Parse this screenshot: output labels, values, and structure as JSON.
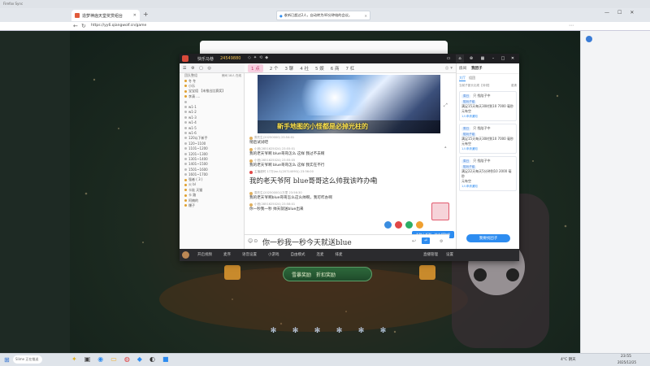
{
  "window_top": {
    "left_text": "Firefox Sync"
  },
  "tabs": [
    {
      "label": "造梦神庙天堂奖赏组台",
      "active": true
    },
    {
      "label": "",
      "active": false
    }
  ],
  "notification": {
    "text": "收听已超过2人，自动转为40分钟结的会议。"
  },
  "address": {
    "url": "https://yy6.qiangwolf.cn/game"
  },
  "app": {
    "title": {
      "brand": "快乐马巷",
      "id": "24549880"
    },
    "toolbar": {
      "label": "团队整组",
      "right_text": "房间 18人 在线"
    },
    "page_tabs": [
      "1 点",
      "2 个",
      "3 聊",
      "4 社",
      "5 娱",
      "6 商",
      "7 杠"
    ],
    "users": [
      "冬 冬",
      "小乐",
      "宝宝组 【未推出比赛奖】",
      "李清 ....",
      "",
      "w1-1",
      "w1-2",
      "w1-3",
      "w1-4",
      "w1-5",
      "w1-6",
      "120以下新手",
      "120~1100",
      "1101~1200",
      "1201~1300",
      "1301~1400",
      "1401~1500",
      "1501~1600",
      "1601~1700",
      "强者 ( 3 )",
      "火 bl",
      "卡娃 天猫",
      "卡 路",
      "阿楠的",
      "爆子"
    ],
    "video_caption": "新手地图的小怪都是必掉光柱的",
    "chat": [
      {
        "user": "周先生(20250000) 23:54:01",
        "text": "稍后试试吧"
      },
      {
        "user": "小宫(2851625024) 23:55:01",
        "text": "我的老天爷啊 blue哥哥怎么 这样 我过不去啊"
      },
      {
        "user": "小宫(2851625024) 23:55:05",
        "text": "我的老天爷啊 blue哥哥怎么 这样 我实在不行"
      },
      {
        "user": "主播超时 17万(wr人(20714090)) 23:56:00",
        "text": "我的老天爷阿 blue哥哥这么帅我该咋办嘞",
        "big": true
      },
      {
        "user": "周先生(20250000)1万里 23:56:30",
        "text": "我的老天爷啊blue哥哥怎么这么帅啊，我可咋办啊"
      },
      {
        "user": "小宫(2851625024) 23:58:01",
        "text": "你一秒我一秒 帅天就送blue出来"
      }
    ],
    "input_text": "你一秒我一秒今天就送blue",
    "gift_popup": "礼物上新啦，快去领取吧",
    "statusbar": {
      "left_items": [
        "开启视频",
        "麦序",
        "语音设置",
        "小游戏",
        "自由模式",
        "连麦",
        "排麦"
      ],
      "right_items": [
        "直播管理",
        "设置"
      ]
    },
    "tribe": {
      "header_tabs": [
        "房间",
        "我团子"
      ],
      "active_tab": "我团子",
      "subtabs": [
        "大厅",
        "组团"
      ],
      "filter": "当前子团长出现【待领】",
      "filter_right": "邀请",
      "cards": [
        {
          "tag": "周日",
          "status": "只 找陪子中",
          "sub": "陪玩子组",
          "text": "满足15天每天30时到10 7000 毫秒",
          "foot": "元有空",
          "meta": "1人申请通知"
        },
        {
          "tag": "周日",
          "status": "只 找陪子中",
          "sub": "陪玩子组",
          "text": "满足15天每天30时到10 7000 毫秒",
          "foot": "元有空",
          "meta": "1人申请通知"
        },
        {
          "tag": "周日",
          "status": "只 找陪子中",
          "sub": "陪玩子组",
          "text": "满足22天每天5分钟到10 2000 毫秒",
          "foot": "元有空",
          "meta": "1人申请通知"
        }
      ],
      "cta": "我要找团子"
    }
  },
  "game": {
    "gift_button_left": "雪暴奖励",
    "gift_button_right": "折扣奖励"
  },
  "taskbar": {
    "search_placeholder": "Slime 正在推送",
    "weather": "4°C 阴天",
    "time": "23:55",
    "date": "2025/12/25"
  },
  "colors": {
    "accent": "#2d8cf0",
    "app_title_bg": "#1f1f22",
    "page_bg": "#1c2a20"
  }
}
